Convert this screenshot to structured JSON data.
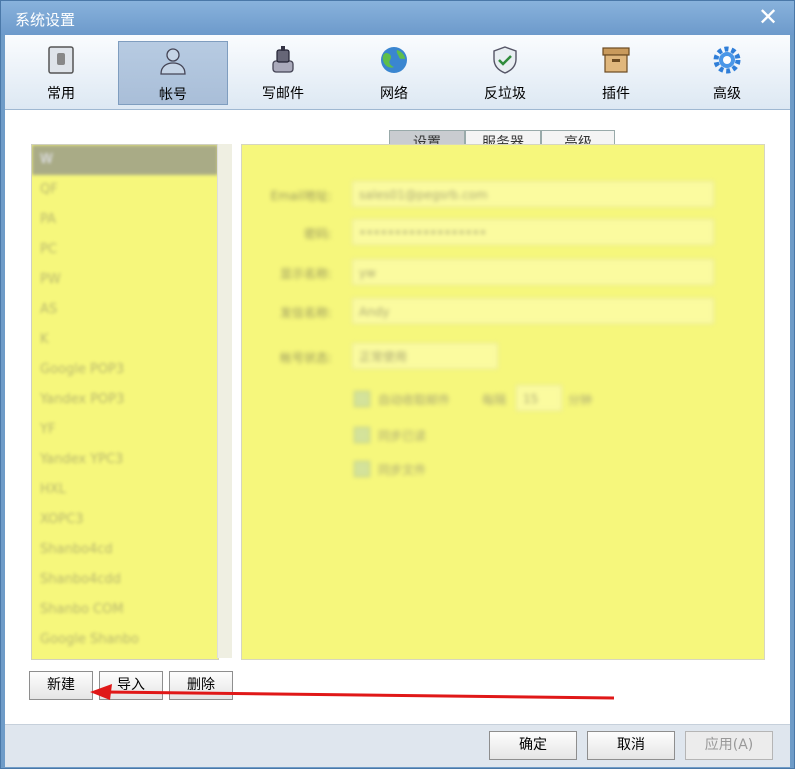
{
  "window": {
    "title": "系统设置",
    "close_symbol": "✕"
  },
  "toolbar": {
    "items": [
      {
        "label": "常用",
        "icon": "general-icon"
      },
      {
        "label": "帐号",
        "icon": "account-icon"
      },
      {
        "label": "写邮件",
        "icon": "compose-icon"
      },
      {
        "label": "网络",
        "icon": "network-icon"
      },
      {
        "label": "反垃圾",
        "icon": "antispam-icon"
      },
      {
        "label": "插件",
        "icon": "plugin-icon"
      },
      {
        "label": "高级",
        "icon": "advanced-icon"
      }
    ],
    "active_index": 1
  },
  "accounts": {
    "items": [
      "W",
      "QF",
      "PA",
      "PC",
      "PW",
      "AS",
      "K",
      "Google POP3",
      "Yandex POP3",
      "YF",
      "Yandex YPC3",
      "HXL",
      "XOPC3",
      "Shanbo4cd",
      "Shanbo4cdd",
      "Shanbo COM",
      "Google Shanbo"
    ],
    "selected_index": 0
  },
  "tabs": {
    "settings": "设置",
    "server": "服务器",
    "advanced": "高级"
  },
  "form": {
    "email_label": "Email地址:",
    "email_value": "sales01@pegsrb.com",
    "password_label": "密码:",
    "password_value": "••••••••••••••••••",
    "display_label": "显示名称:",
    "display_value": "yw",
    "reply_label": "发信名称:",
    "reply_value": "Andy",
    "status_label": "帐号状态:",
    "status_value": "正常使用",
    "check1": "自动收取邮件",
    "interval_prefix": "每隔",
    "interval_value": "15",
    "interval_suffix": "分钟",
    "check2": "同步已读",
    "check3": "同步文件"
  },
  "actions": {
    "new": "新建",
    "import": "导入",
    "delete": "删除"
  },
  "footer": {
    "ok": "确定",
    "cancel": "取消",
    "apply": "应用(A)"
  },
  "colors": {
    "highlight": "#f6f77c",
    "annotation_arrow": "#e01818"
  }
}
